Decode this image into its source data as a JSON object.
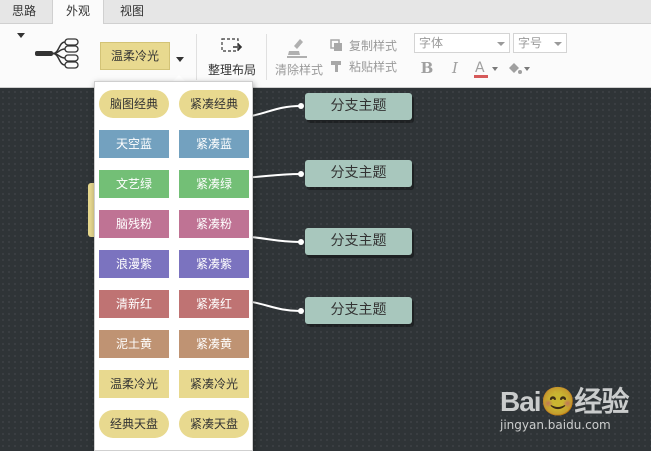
{
  "tabs": [
    {
      "label": "思路"
    },
    {
      "label": "外观"
    },
    {
      "label": "视图"
    }
  ],
  "toolbar": {
    "current_theme": "温柔冷光",
    "layout_label": "整理布局",
    "clear_style_label": "清除样式",
    "copy_style_label": "复制样式",
    "paste_style_label": "粘贴样式",
    "font_placeholder": "字体",
    "size_placeholder": "字号",
    "bold_label": "B",
    "italic_label": "I",
    "font_color_label": "A",
    "font_color": "#d65a5a",
    "icons": [
      "structure-icon",
      "layout-icon",
      "brush-icon",
      "copy-icon",
      "paste-icon",
      "fill-color-icon"
    ]
  },
  "theme_menu": {
    "items": [
      {
        "label": "脑图经典",
        "bg": "#e8d98f",
        "fg": "#333333",
        "shape": "oval"
      },
      {
        "label": "紧凑经典",
        "bg": "#e8d98f",
        "fg": "#333333",
        "shape": "oval"
      },
      {
        "label": "天空蓝",
        "bg": "#73a1bf",
        "fg": "#ffffff",
        "shape": "rect"
      },
      {
        "label": "紧凑蓝",
        "bg": "#73a1bf",
        "fg": "#ffffff",
        "shape": "rect"
      },
      {
        "label": "文艺绿",
        "bg": "#73bf76",
        "fg": "#ffffff",
        "shape": "rect"
      },
      {
        "label": "紧凑绿",
        "bg": "#73bf76",
        "fg": "#ffffff",
        "shape": "rect"
      },
      {
        "label": "脑残粉",
        "bg": "#bf7394",
        "fg": "#ffffff",
        "shape": "rect"
      },
      {
        "label": "紧凑粉",
        "bg": "#bf7394",
        "fg": "#ffffff",
        "shape": "rect"
      },
      {
        "label": "浪漫紫",
        "bg": "#7b73bf",
        "fg": "#ffffff",
        "shape": "rect"
      },
      {
        "label": "紧凑紫",
        "bg": "#7b73bf",
        "fg": "#ffffff",
        "shape": "rect"
      },
      {
        "label": "清新红",
        "bg": "#bf7373",
        "fg": "#ffffff",
        "shape": "rect"
      },
      {
        "label": "紧凑红",
        "bg": "#bf7373",
        "fg": "#ffffff",
        "shape": "rect"
      },
      {
        "label": "泥土黄",
        "bg": "#bf9373",
        "fg": "#ffffff",
        "shape": "rect"
      },
      {
        "label": "紧凑黄",
        "bg": "#bf9373",
        "fg": "#ffffff",
        "shape": "rect"
      },
      {
        "label": "温柔冷光",
        "bg": "#e8d98f",
        "fg": "#333333",
        "shape": "rect"
      },
      {
        "label": "紧凑冷光",
        "bg": "#e8d98f",
        "fg": "#333333",
        "shape": "rect"
      },
      {
        "label": "经典天盘",
        "bg": "#e8d98f",
        "fg": "#333333",
        "shape": "oval"
      },
      {
        "label": "紧凑天盘",
        "bg": "#e8d98f",
        "fg": "#333333",
        "shape": "oval"
      }
    ]
  },
  "canvas": {
    "branch_topics": [
      {
        "label": "分支主题"
      },
      {
        "label": "分支主题"
      },
      {
        "label": "分支主题"
      },
      {
        "label": "分支主题"
      }
    ]
  },
  "watermark": {
    "logo": "Bai😊经验",
    "url": "jingyan.baidu.com"
  }
}
